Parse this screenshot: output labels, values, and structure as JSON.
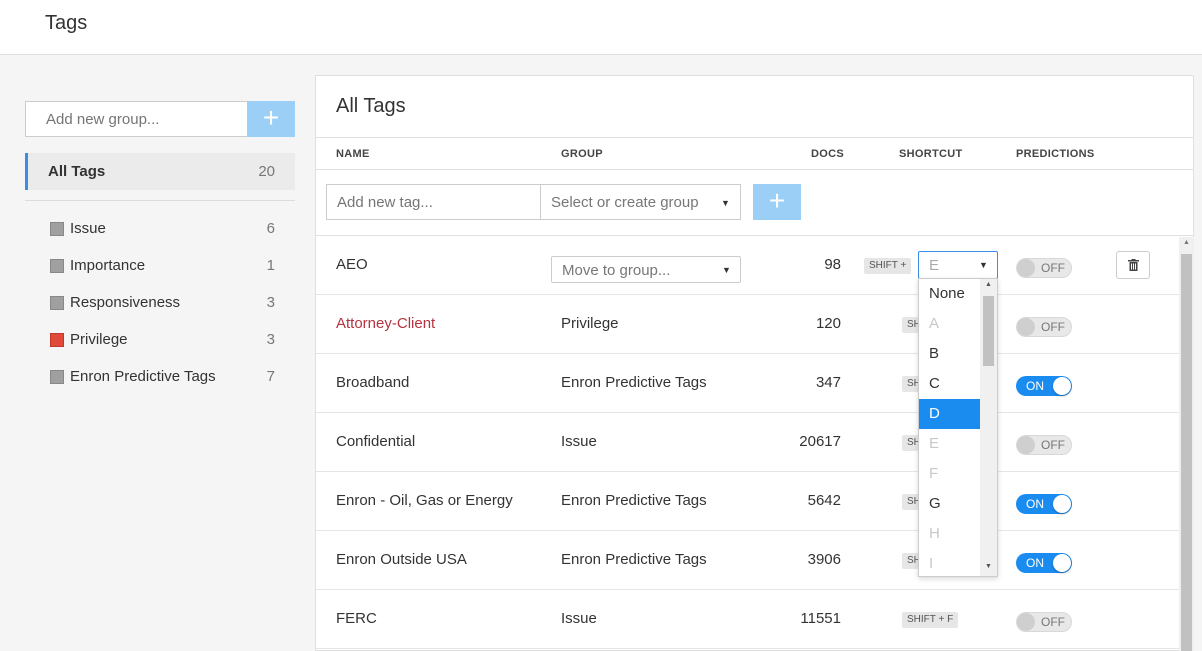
{
  "page_title": "Tags",
  "sidebar": {
    "add_group_placeholder": "Add new group...",
    "add_group_button": "+",
    "all_tags": {
      "label": "All Tags",
      "count": "20"
    },
    "groups": [
      {
        "name": "Issue",
        "count": "6",
        "color": "#a0a0a0"
      },
      {
        "name": "Importance",
        "count": "1",
        "color": "#a0a0a0"
      },
      {
        "name": "Responsiveness",
        "count": "3",
        "color": "#a0a0a0"
      },
      {
        "name": "Privilege",
        "count": "3",
        "color": "#e04a3a"
      },
      {
        "name": "Enron Predictive Tags",
        "count": "7",
        "color": "#a0a0a0"
      }
    ]
  },
  "main": {
    "title": "All Tags",
    "columns": {
      "name": "NAME",
      "group": "GROUP",
      "docs": "DOCS",
      "shortcut": "SHORTCUT",
      "predictions": "PREDICTIONS"
    },
    "new_tag_placeholder": "Add new tag...",
    "new_group_placeholder": "Select or create group",
    "add_tag_button": "+",
    "move_to_group_placeholder": "Move to group...",
    "rows": [
      {
        "name": "AEO",
        "group": "",
        "docs": "98",
        "shortcut": "SHIFT +",
        "shortcut_value": "E",
        "prediction": "OFF",
        "name_color": "#333333"
      },
      {
        "name": "Attorney-Client",
        "group": "Privilege",
        "docs": "120",
        "shortcut": "SHIFT +",
        "prediction": "OFF",
        "name_color": "#b33440"
      },
      {
        "name": "Broadband",
        "group": "Enron Predictive Tags",
        "docs": "347",
        "shortcut": "SHIFT +",
        "prediction": "ON",
        "name_color": "#333333"
      },
      {
        "name": "Confidential",
        "group": "Issue",
        "docs": "20617",
        "shortcut": "SHIFT +",
        "prediction": "OFF",
        "name_color": "#333333"
      },
      {
        "name": "Enron - Oil, Gas or Energy",
        "group": "Enron Predictive Tags",
        "docs": "5642",
        "shortcut": "SHIFT +",
        "prediction": "ON",
        "name_color": "#333333"
      },
      {
        "name": "Enron Outside USA",
        "group": "Enron Predictive Tags",
        "docs": "3906",
        "shortcut": "SHIFT +",
        "prediction": "ON",
        "name_color": "#333333"
      },
      {
        "name": "FERC",
        "group": "Issue",
        "docs": "11551",
        "shortcut": "SHIFT + F",
        "prediction": "OFF",
        "name_color": "#333333"
      }
    ],
    "shortcut_dropdown": {
      "options": [
        {
          "label": "None",
          "state": "enabled"
        },
        {
          "label": "A",
          "state": "disabled"
        },
        {
          "label": "B",
          "state": "enabled"
        },
        {
          "label": "C",
          "state": "enabled"
        },
        {
          "label": "D",
          "state": "selected"
        },
        {
          "label": "E",
          "state": "disabled"
        },
        {
          "label": "F",
          "state": "disabled"
        },
        {
          "label": "G",
          "state": "enabled"
        },
        {
          "label": "H",
          "state": "disabled"
        },
        {
          "label": "I",
          "state": "disabled"
        }
      ]
    }
  },
  "colors": {
    "accent": "#1a8cf0",
    "add_button": "#9ccff6",
    "selected_border": "#3a8ee6"
  }
}
